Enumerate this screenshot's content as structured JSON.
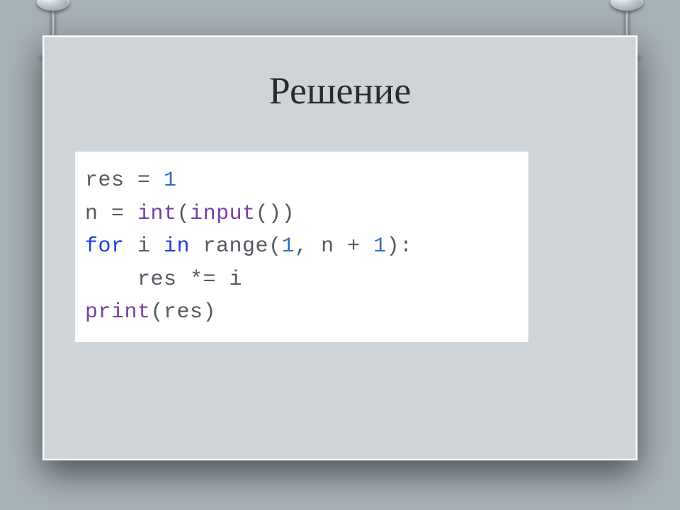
{
  "title": "Решение",
  "code": {
    "line1": {
      "a": "res ",
      "op": "=",
      "b": " ",
      "n": "1"
    },
    "line2": {
      "a": "n ",
      "op": "=",
      "b": " ",
      "fn1": "int",
      "p1": "(",
      "fn2": "input",
      "p2": "())"
    },
    "line3": {
      "kw1": "for",
      "s1": " i ",
      "kw2": "in",
      "s2": " range(",
      "n1": "1",
      "c": ", n ",
      "op": "+",
      "s3": " ",
      "n2": "1",
      "p": "):"
    },
    "line4": {
      "indent": "    ",
      "a": "res ",
      "op": "*=",
      "b": " i"
    },
    "line5": {
      "fn": "print",
      "p1": "(res)"
    }
  }
}
